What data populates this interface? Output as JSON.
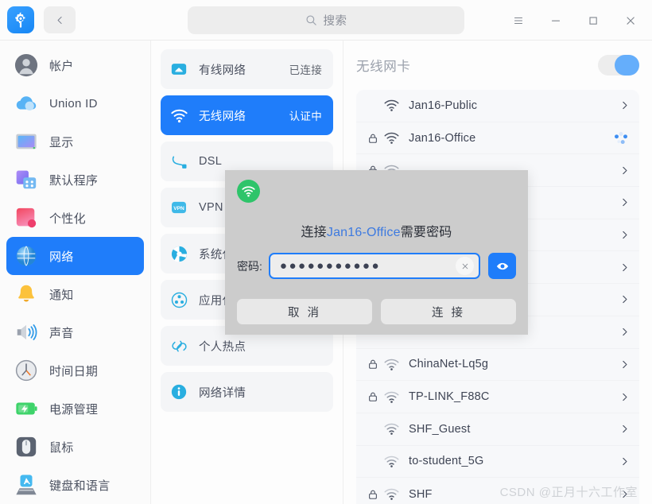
{
  "titlebar": {
    "app_icon": "settings-gear-icon",
    "back_icon": "chevron-left-icon",
    "search": {
      "icon": "search-icon",
      "placeholder": "搜索",
      "value": ""
    },
    "controls": [
      {
        "name": "menu-button",
        "icon": "hamburger-icon"
      },
      {
        "name": "minimize-button",
        "icon": "minimize-icon"
      },
      {
        "name": "maximize-button",
        "icon": "maximize-icon"
      },
      {
        "name": "close-button",
        "icon": "close-icon"
      }
    ]
  },
  "sidebar": {
    "items": [
      {
        "label": "帐户",
        "icon": "account-avatar-icon",
        "active": false
      },
      {
        "label": "Union ID",
        "icon": "cloud-icon",
        "active": false
      },
      {
        "label": "显示",
        "icon": "monitor-icon",
        "active": false
      },
      {
        "label": "默认程序",
        "icon": "default-apps-icon",
        "active": false
      },
      {
        "label": "个性化",
        "icon": "personalization-icon",
        "active": false
      },
      {
        "label": "网络",
        "icon": "network-globe-icon",
        "active": true
      },
      {
        "label": "通知",
        "icon": "bell-icon",
        "active": false
      },
      {
        "label": "声音",
        "icon": "speaker-icon",
        "active": false
      },
      {
        "label": "时间日期",
        "icon": "clock-icon",
        "active": false
      },
      {
        "label": "电源管理",
        "icon": "battery-icon",
        "active": false
      },
      {
        "label": "鼠标",
        "icon": "mouse-icon",
        "active": false
      },
      {
        "label": "键盘和语言",
        "icon": "keyboard-icon",
        "active": false
      }
    ]
  },
  "midpanel": {
    "items": [
      {
        "label": "有线网络",
        "status": "已连接",
        "icon": "ethernet-icon",
        "active": false
      },
      {
        "label": "无线网络",
        "status": "认证中",
        "icon": "wifi-icon",
        "active": true
      },
      {
        "label": "DSL",
        "status": "",
        "icon": "dsl-icon",
        "active": false
      },
      {
        "label": "VPN",
        "status": "",
        "icon": "vpn-icon",
        "active": false
      },
      {
        "label": "系统代理",
        "status": "",
        "icon": "proxy-icon",
        "active": false
      },
      {
        "label": "应用代理",
        "status": "",
        "icon": "app-proxy-icon",
        "active": false
      },
      {
        "label": "个人热点",
        "status": "",
        "icon": "hotspot-icon",
        "active": false
      },
      {
        "label": "网络详情",
        "status": "",
        "icon": "info-icon",
        "active": false
      }
    ]
  },
  "rightpanel": {
    "title": "无线网卡",
    "toggle": {
      "name": "wireless-adapter-toggle",
      "on": true,
      "color": "#65aefb"
    },
    "networks": [
      {
        "ssid": "Jan16-Public",
        "secured": false,
        "state": "idle"
      },
      {
        "ssid": "Jan16-Office",
        "secured": true,
        "state": "connecting"
      },
      {
        "ssid": "",
        "secured": true,
        "state": "idle"
      },
      {
        "ssid": "",
        "secured": true,
        "state": "idle"
      },
      {
        "ssid": "",
        "secured": true,
        "state": "idle"
      },
      {
        "ssid": "",
        "secured": true,
        "state": "idle"
      },
      {
        "ssid": "",
        "secured": true,
        "state": "idle"
      },
      {
        "ssid": "",
        "secured": true,
        "state": "idle"
      },
      {
        "ssid": "ChinaNet-Lq5g",
        "secured": true,
        "state": "idle"
      },
      {
        "ssid": "TP-LINK_F88C",
        "secured": true,
        "state": "idle"
      },
      {
        "ssid": "SHF_Guest",
        "secured": false,
        "state": "idle"
      },
      {
        "ssid": "to-student_5G",
        "secured": false,
        "state": "idle"
      },
      {
        "ssid": "SHF",
        "secured": true,
        "state": "idle"
      }
    ]
  },
  "dialog": {
    "icon": "wifi-green-icon",
    "title_prefix": "连接",
    "title_ssid": "Jan16-Office",
    "title_suffix": "需要密码",
    "password_label": "密码:",
    "password_value": "●●●●●●●●●●●",
    "clear_icon": "close-small-icon",
    "reveal_icon": "eye-icon",
    "cancel_label": "取 消",
    "connect_label": "连 接",
    "accent_color": "#1f7dfa",
    "ssid_color": "#3d7ae0"
  },
  "watermark": "CSDN @正月十六工作室"
}
